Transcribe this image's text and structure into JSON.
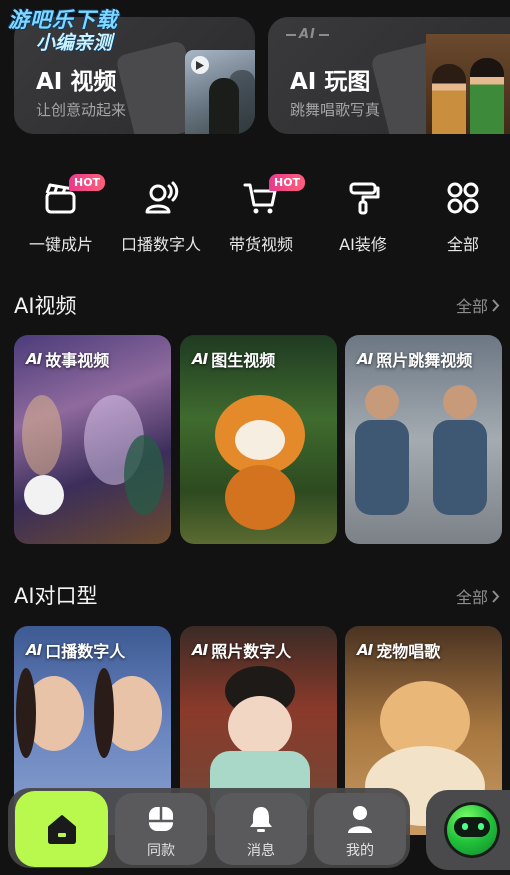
{
  "watermark": {
    "line1": "游吧乐下载",
    "line2": "小编亲测"
  },
  "features": [
    {
      "title": "AI 视频",
      "subtitle": "让创意动起来"
    },
    {
      "title": "AI 玩图",
      "subtitle": "跳舞唱歌写真",
      "tag": "AI"
    }
  ],
  "quick_actions": [
    {
      "label": "一键成片",
      "icon": "clapperboard-icon",
      "badge": "HOT"
    },
    {
      "label": "口播数字人",
      "icon": "speaking-person-icon",
      "badge": ""
    },
    {
      "label": "带货视频",
      "icon": "shopping-cart-icon",
      "badge": "HOT"
    },
    {
      "label": "AI装修",
      "icon": "paint-roller-icon",
      "badge": ""
    },
    {
      "label": "全部",
      "icon": "grid-dots-icon",
      "badge": ""
    }
  ],
  "sections": [
    {
      "title": "AI视频",
      "more": "全部",
      "cards": [
        {
          "ai": "AI",
          "label": "故事视频"
        },
        {
          "ai": "AI",
          "label": "图生视频"
        },
        {
          "ai": "AI",
          "label": "照片跳舞视频"
        }
      ]
    },
    {
      "title": "AI对口型",
      "more": "全部",
      "cards": [
        {
          "ai": "AI",
          "label": "口播数字人"
        },
        {
          "ai": "AI",
          "label": "照片数字人"
        },
        {
          "ai": "AI",
          "label": "宠物唱歌"
        }
      ]
    }
  ],
  "nav": [
    {
      "label": "",
      "icon": "home-icon"
    },
    {
      "label": "同款",
      "icon": "same-style-icon"
    },
    {
      "label": "消息",
      "icon": "bell-icon"
    },
    {
      "label": "我的",
      "icon": "profile-icon"
    }
  ],
  "colors": {
    "accent": "#b9f84c",
    "hot_badge": "#e83a8c",
    "background": "#121212"
  }
}
